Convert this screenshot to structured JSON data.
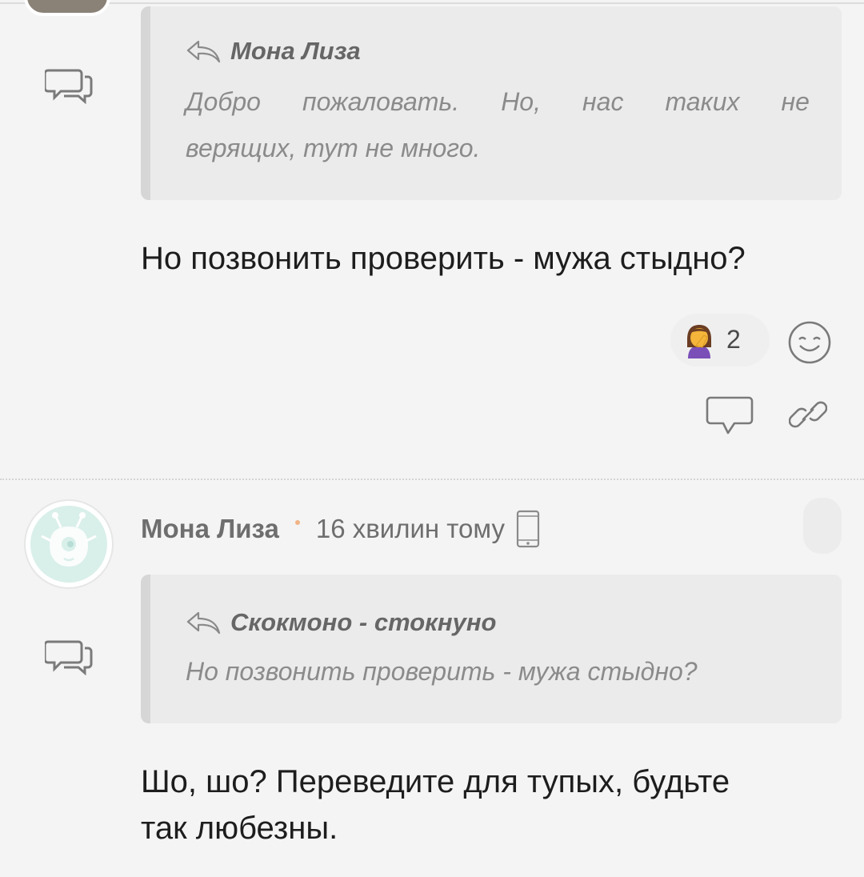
{
  "comment1": {
    "quote": {
      "author": "Мона Лиза",
      "text_line1": [
        "Добро",
        "пожаловать.",
        "Но,",
        "нас",
        "таких",
        "не"
      ],
      "text_line2": "верящих, тут не много."
    },
    "message": "Но позвонить проверить - мужа стыдно?",
    "reaction": {
      "emoji_icon": "woman-facepalming-icon",
      "count": "2"
    }
  },
  "comment2": {
    "author": "Мона Лиза",
    "time": "16 хвилин тому",
    "quote": {
      "author": "Скокмоно - стокнуно",
      "text": "Но позвонить проверить - мужа стыдно?"
    },
    "message_line1": "Шо, шо? Переведите для тупых, будьте",
    "message_line2": "так любезны."
  },
  "colors": {
    "background": "#f4f4f4",
    "quote_background": "#ebebeb",
    "quote_bar": "#d6d6d6",
    "author_dot": "#f0b487",
    "avatar_mint": "#d9efea"
  }
}
